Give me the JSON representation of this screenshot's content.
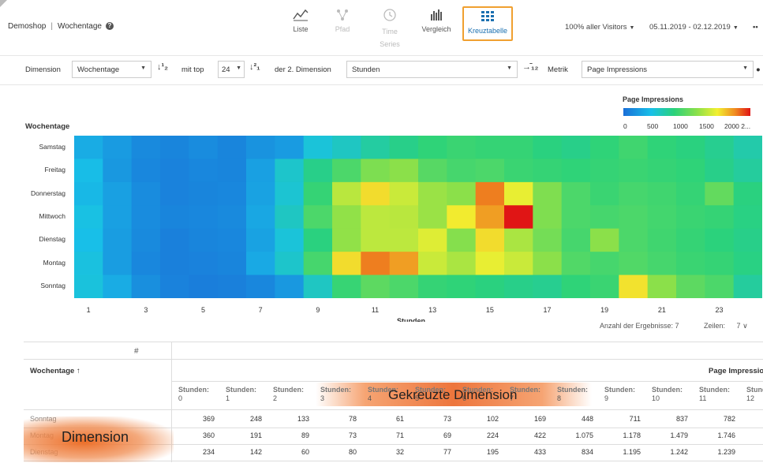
{
  "header": {
    "shop": "Demoshop",
    "separator": "|",
    "report": "Wochentage",
    "help": "?",
    "views": [
      {
        "label": "Liste",
        "state": "normal"
      },
      {
        "label": "Pfad",
        "state": "disabled"
      },
      {
        "label": "Time Series",
        "state": "disabled"
      },
      {
        "label": "Vergleich",
        "state": "normal"
      },
      {
        "label": "Kreuztabelle",
        "state": "active"
      }
    ],
    "segment": "100% aller Visitors",
    "daterange": "05.11.2019 - 02.12.2019",
    "more": "••"
  },
  "controls": {
    "dimension_label": "Dimension",
    "dimension_value": "Wochentage",
    "mit_top_label": "mit top",
    "top_value": "24",
    "second_dim_label": "der 2. Dimension",
    "second_dim_value": "Stunden",
    "metrik_label": "Metrik",
    "metrik_value": "Page Impressions"
  },
  "legend": {
    "title": "Page Impressions",
    "ticks": [
      "0",
      "500",
      "1000",
      "1500",
      "2000 2..."
    ]
  },
  "chart_data": {
    "type": "heatmap",
    "ytitle": "Wochentage",
    "xtitle": "Stunden",
    "rows": [
      "Samstag",
      "Freitag",
      "Donnerstag",
      "Mittwoch",
      "Dienstag",
      "Montag",
      "Sonntag"
    ],
    "x_ticks": [
      "1",
      "3",
      "5",
      "7",
      "9",
      "11",
      "13",
      "15",
      "17",
      "19",
      "21",
      "23"
    ],
    "color_range": [
      0,
      2000
    ],
    "colors": [
      "#1a6fd8",
      "#18c0e8",
      "#2bd27a",
      "#8be04a",
      "#f2f030",
      "#f08a20",
      "#e01515"
    ],
    "values": [
      [
        250,
        180,
        110,
        90,
        120,
        90,
        150,
        180,
        380,
        450,
        550,
        620,
        680,
        720,
        700,
        700,
        650,
        620,
        680,
        740,
        680,
        650,
        600,
        520
      ],
      [
        320,
        170,
        100,
        80,
        100,
        90,
        200,
        420,
        620,
        780,
        950,
        1000,
        820,
        760,
        780,
        720,
        700,
        680,
        700,
        720,
        700,
        680,
        620,
        560
      ],
      [
        300,
        200,
        120,
        80,
        90,
        100,
        210,
        400,
        700,
        1150,
        1400,
        1200,
        1050,
        1000,
        1700,
        1300,
        960,
        780,
        720,
        760,
        740,
        700,
        860,
        650
      ],
      [
        350,
        200,
        120,
        90,
        100,
        110,
        230,
        450,
        780,
        1020,
        1160,
        1150,
        1050,
        1350,
        1600,
        2300,
        960,
        780,
        760,
        780,
        750,
        720,
        700,
        640
      ],
      [
        330,
        190,
        110,
        70,
        90,
        100,
        210,
        380,
        650,
        1020,
        1160,
        1160,
        1270,
        980,
        1400,
        1100,
        920,
        760,
        1000,
        780,
        740,
        700,
        660,
        620
      ],
      [
        360,
        190,
        100,
        70,
        80,
        90,
        240,
        420,
        760,
        1400,
        1700,
        1600,
        1200,
        1100,
        1300,
        1200,
        1000,
        800,
        760,
        800,
        760,
        720,
        700,
        640
      ],
      [
        370,
        250,
        130,
        80,
        60,
        70,
        100,
        170,
        450,
        710,
        840,
        780,
        700,
        680,
        650,
        620,
        600,
        680,
        720,
        1380,
        1000,
        840,
        780,
        560
      ]
    ]
  },
  "results": {
    "count_label": "Anzahl der Ergebnisse: 7",
    "rows_label": "Zeilen:",
    "rows_value": "7",
    "rows_caret": "∨"
  },
  "table": {
    "hash": "#",
    "dim_header": "Wochentage ↑",
    "metric_header": "Page Impressio",
    "col_prefix": "Stunden:",
    "columns": [
      "0",
      "1",
      "2",
      "3",
      "4",
      "5",
      "6",
      "7",
      "8",
      "9",
      "10",
      "11",
      "12"
    ],
    "rows": [
      {
        "label": "Sonntag",
        "cells": [
          "369",
          "248",
          "133",
          "78",
          "61",
          "73",
          "102",
          "169",
          "448",
          "711",
          "837",
          "782"
        ]
      },
      {
        "label": "Montag",
        "cells": [
          "360",
          "191",
          "89",
          "73",
          "71",
          "69",
          "224",
          "422",
          "1.075",
          "1.178",
          "1.479",
          "1.746"
        ]
      },
      {
        "label": "Dienstag",
        "cells": [
          "234",
          "142",
          "60",
          "80",
          "32",
          "77",
          "195",
          "433",
          "834",
          "1.195",
          "1.242",
          "1.239"
        ]
      }
    ],
    "annotation_cross": "Gekreuzte Dimension",
    "annotation_dim": "Dimension"
  }
}
